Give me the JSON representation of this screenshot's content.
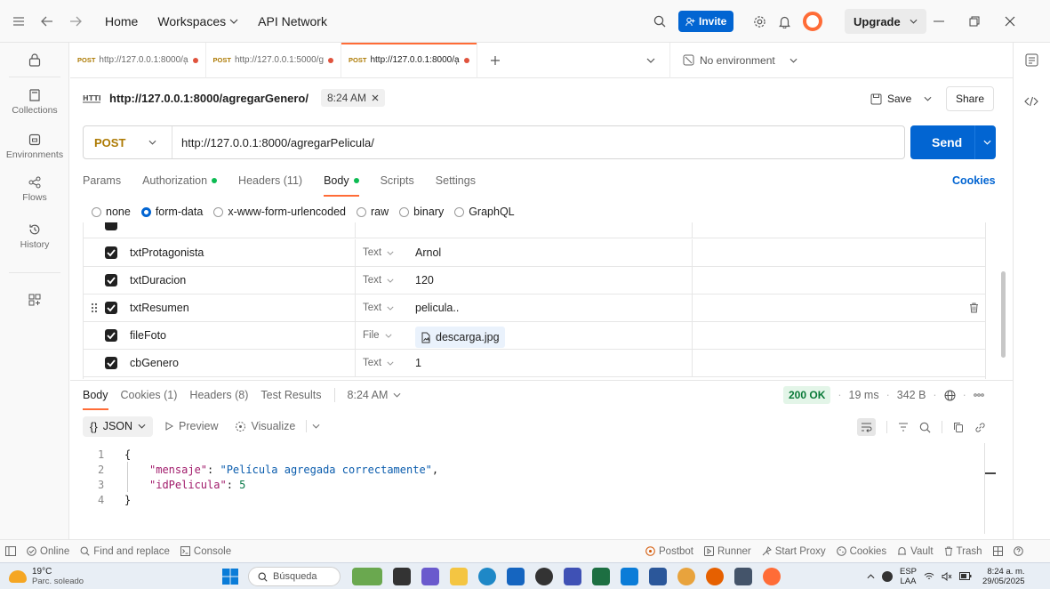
{
  "topbar": {
    "nav": [
      "Home",
      "Workspaces",
      "API Network"
    ],
    "invite_label": "Invite",
    "upgrade_label": "Upgrade"
  },
  "rail": {
    "items": [
      {
        "label": "Collections",
        "icon": "collections-icon"
      },
      {
        "label": "Environments",
        "icon": "environments-icon"
      },
      {
        "label": "Flows",
        "icon": "flows-icon"
      },
      {
        "label": "History",
        "icon": "history-icon"
      }
    ]
  },
  "tabs": {
    "items": [
      {
        "method": "POST",
        "label": "http://127.0.0.1:8000/a̦"
      },
      {
        "method": "POST",
        "label": "http://127.0.0.1:5000/g"
      },
      {
        "method": "POST",
        "label": "http://127.0.0.1:8000/a̦"
      }
    ],
    "environment": "No environment"
  },
  "request": {
    "title": "http://127.0.0.1:8000/agregarGenero/",
    "time_badge": "8:24 AM",
    "save_label": "Save",
    "share_label": "Share",
    "method": "POST",
    "url": "http://127.0.0.1:8000/agregarPelicula/",
    "send_label": "Send",
    "subtabs": [
      "Params",
      "Authorization",
      "Headers (11)",
      "Body",
      "Scripts",
      "Settings"
    ],
    "cookies_label": "Cookies",
    "body_modes": [
      "none",
      "form-data",
      "x-www-form-urlencoded",
      "raw",
      "binary",
      "GraphQL"
    ]
  },
  "form": {
    "rows": [
      {
        "key": "txtProtagonista",
        "type": "Text",
        "value": "Arnol"
      },
      {
        "key": "txtDuracion",
        "type": "Text",
        "value": "120"
      },
      {
        "key": "txtResumen",
        "type": "Text",
        "value": "pelicula.."
      },
      {
        "key": "fileFoto",
        "type": "File",
        "value": "descarga.jpg"
      },
      {
        "key": "cbGenero",
        "type": "Text",
        "value": "1"
      }
    ]
  },
  "response": {
    "tabs": [
      "Body",
      "Cookies (1)",
      "Headers (8)",
      "Test Results"
    ],
    "time": "8:24 AM",
    "status": "200 OK",
    "duration": "19 ms",
    "size": "342 B",
    "format_label": "JSON",
    "preview_label": "Preview",
    "visualize_label": "Visualize",
    "lines": [
      {
        "n": "1",
        "text": "{"
      },
      {
        "n": "2",
        "key": "\"mensaje\"",
        "value": "\"Película agregada correctamente\"",
        "sep": ","
      },
      {
        "n": "3",
        "key": "\"idPelicula\"",
        "num": "5"
      },
      {
        "n": "4",
        "text": "}"
      }
    ]
  },
  "statusbar": {
    "online": "Online",
    "find": "Find and replace",
    "console": "Console",
    "right": [
      "Postbot",
      "Runner",
      "Start Proxy",
      "Cookies",
      "Vault",
      "Trash"
    ]
  },
  "taskbar": {
    "temp": "19°C",
    "weather": "Parc. soleado",
    "search": "Búsqueda",
    "lang1": "ESP",
    "lang2": "LAA",
    "time": "8:24 a. m.",
    "date": "29/05/2025"
  }
}
